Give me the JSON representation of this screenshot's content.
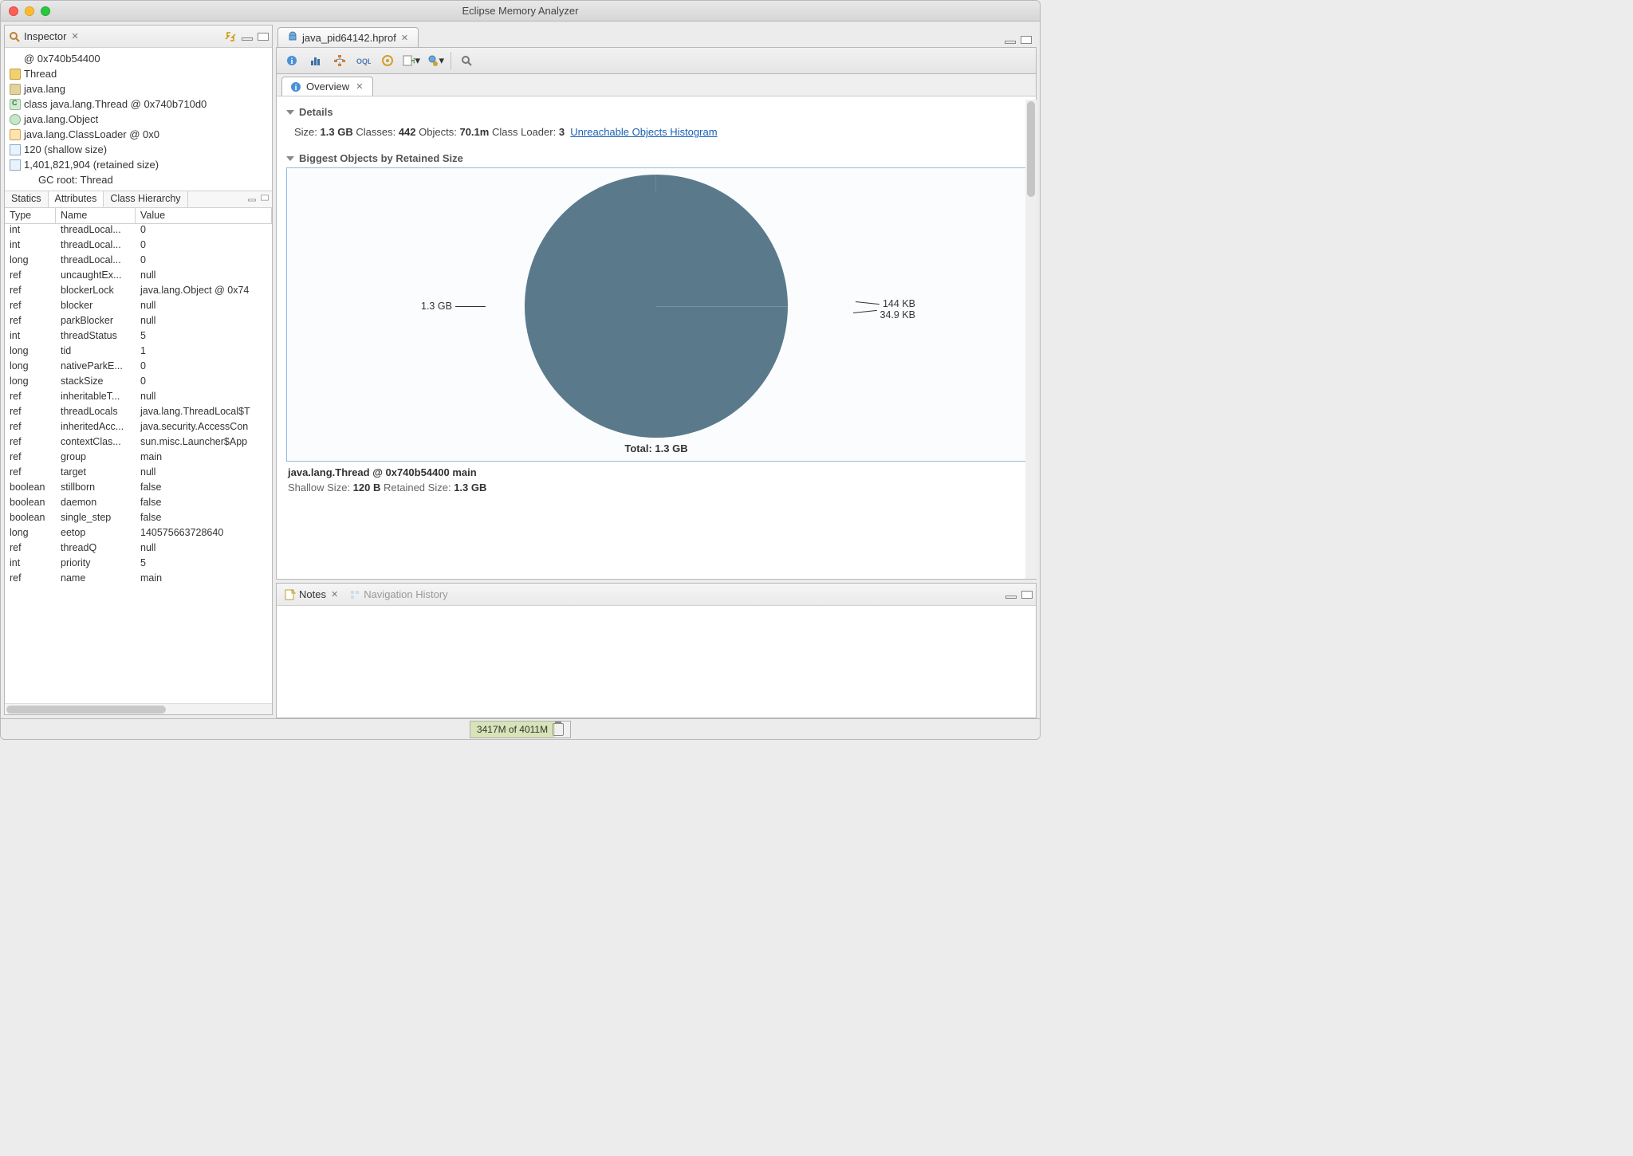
{
  "window": {
    "title": "Eclipse Memory Analyzer"
  },
  "inspector": {
    "title": "Inspector",
    "rows": [
      {
        "icon": "at",
        "text": "0x740b54400"
      },
      {
        "icon": "thread",
        "text": "Thread"
      },
      {
        "icon": "pkg",
        "text": "java.lang"
      },
      {
        "icon": "class",
        "text": "class java.lang.Thread @ 0x740b710d0"
      },
      {
        "icon": "obj",
        "text": "java.lang.Object"
      },
      {
        "icon": "cl",
        "text": "java.lang.ClassLoader @ 0x0"
      },
      {
        "icon": "arrow",
        "text": "120 (shallow size)"
      },
      {
        "icon": "arrow",
        "text": "1,401,821,904 (retained size)"
      },
      {
        "icon": "",
        "text": "GC root: Thread"
      }
    ],
    "tabs": [
      "Statics",
      "Attributes",
      "Class Hierarchy"
    ],
    "activeTab": "Attributes",
    "columns": [
      "Type",
      "Name",
      "Value"
    ],
    "attrs": [
      {
        "type": "int",
        "name": "threadLocal...",
        "value": "0"
      },
      {
        "type": "int",
        "name": "threadLocal...",
        "value": "0"
      },
      {
        "type": "long",
        "name": "threadLocal...",
        "value": "0"
      },
      {
        "type": "ref",
        "name": "uncaughtEx...",
        "value": "null"
      },
      {
        "type": "ref",
        "name": "blockerLock",
        "value": "java.lang.Object @ 0x74"
      },
      {
        "type": "ref",
        "name": "blocker",
        "value": "null"
      },
      {
        "type": "ref",
        "name": "parkBlocker",
        "value": "null"
      },
      {
        "type": "int",
        "name": "threadStatus",
        "value": "5"
      },
      {
        "type": "long",
        "name": "tid",
        "value": "1"
      },
      {
        "type": "long",
        "name": "nativeParkE...",
        "value": "0"
      },
      {
        "type": "long",
        "name": "stackSize",
        "value": "0"
      },
      {
        "type": "ref",
        "name": "inheritableT...",
        "value": "null"
      },
      {
        "type": "ref",
        "name": "threadLocals",
        "value": "java.lang.ThreadLocal$T"
      },
      {
        "type": "ref",
        "name": "inheritedAcc...",
        "value": "java.security.AccessCon"
      },
      {
        "type": "ref",
        "name": "contextClas...",
        "value": "sun.misc.Launcher$App"
      },
      {
        "type": "ref",
        "name": "group",
        "value": "main"
      },
      {
        "type": "ref",
        "name": "target",
        "value": "null"
      },
      {
        "type": "boolean",
        "name": "stillborn",
        "value": "false"
      },
      {
        "type": "boolean",
        "name": "daemon",
        "value": "false"
      },
      {
        "type": "boolean",
        "name": "single_step",
        "value": "false"
      },
      {
        "type": "long",
        "name": "eetop",
        "value": "140575663728640"
      },
      {
        "type": "ref",
        "name": "threadQ",
        "value": "null"
      },
      {
        "type": "int",
        "name": "priority",
        "value": "5"
      },
      {
        "type": "ref",
        "name": "name",
        "value": "main"
      }
    ]
  },
  "editor": {
    "tabTitle": "java_pid64142.hprof"
  },
  "overview": {
    "tabTitle": "Overview",
    "detailsTitle": "Details",
    "size_label": "Size:",
    "size_value": "1.3 GB",
    "classes_label": "Classes:",
    "classes_value": "442",
    "objects_label": "Objects:",
    "objects_value": "70.1m",
    "cl_label": "Class Loader:",
    "cl_value": "3",
    "link": "Unreachable Objects Histogram",
    "biggestTitle": "Biggest Objects by Retained Size",
    "pieTotal": "Total: 1.3 GB",
    "objLine": "java.lang.Thread @ 0x740b54400 main",
    "shallow_label": "Shallow Size:",
    "shallow_value": "120 B",
    "retained_label": "Retained Size:",
    "retained_value": "1.3 GB"
  },
  "chart_data": {
    "type": "pie",
    "title": "Biggest Objects by Retained Size",
    "total_label": "Total: 1.3 GB",
    "slices": [
      {
        "label": "1.3 GB",
        "bytes": 1401821904
      },
      {
        "label": "144 KB",
        "bytes": 147456
      },
      {
        "label": "34.9 KB",
        "bytes": 35738
      }
    ]
  },
  "bottom": {
    "notes": "Notes",
    "nav": "Navigation History"
  },
  "status": {
    "heap": "3417M of 4011M"
  }
}
